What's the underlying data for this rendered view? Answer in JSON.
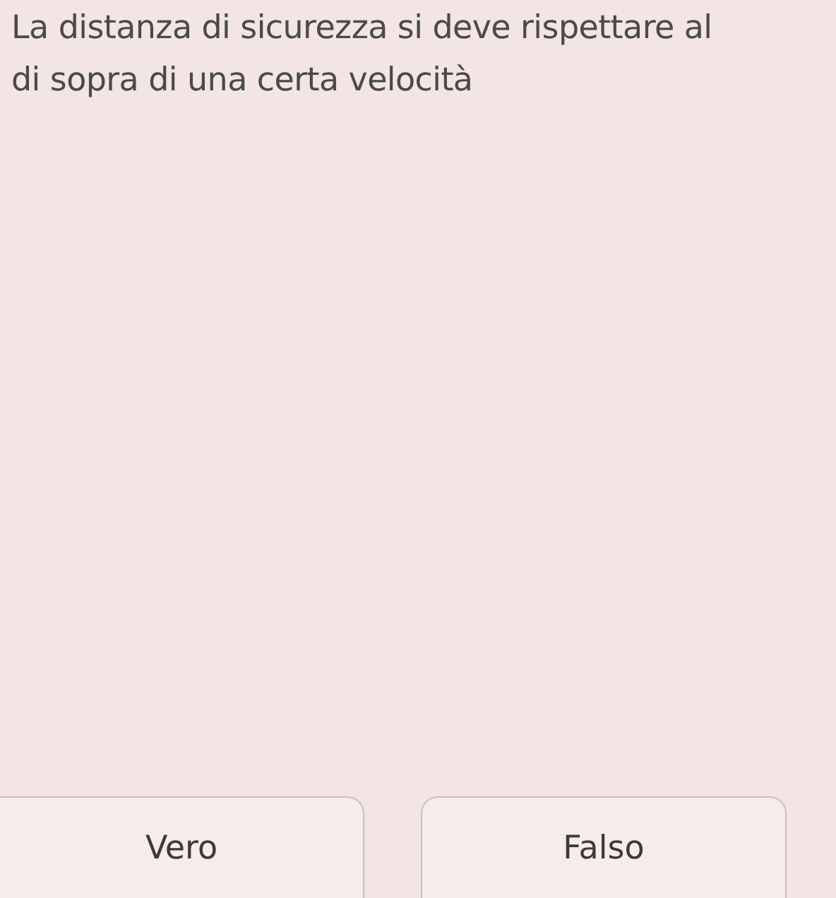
{
  "question": "La distanza di sicurezza si deve rispettare al di sopra di una certa velocità",
  "answers": [
    {
      "label": "Vero"
    },
    {
      "label": "Falso"
    }
  ]
}
